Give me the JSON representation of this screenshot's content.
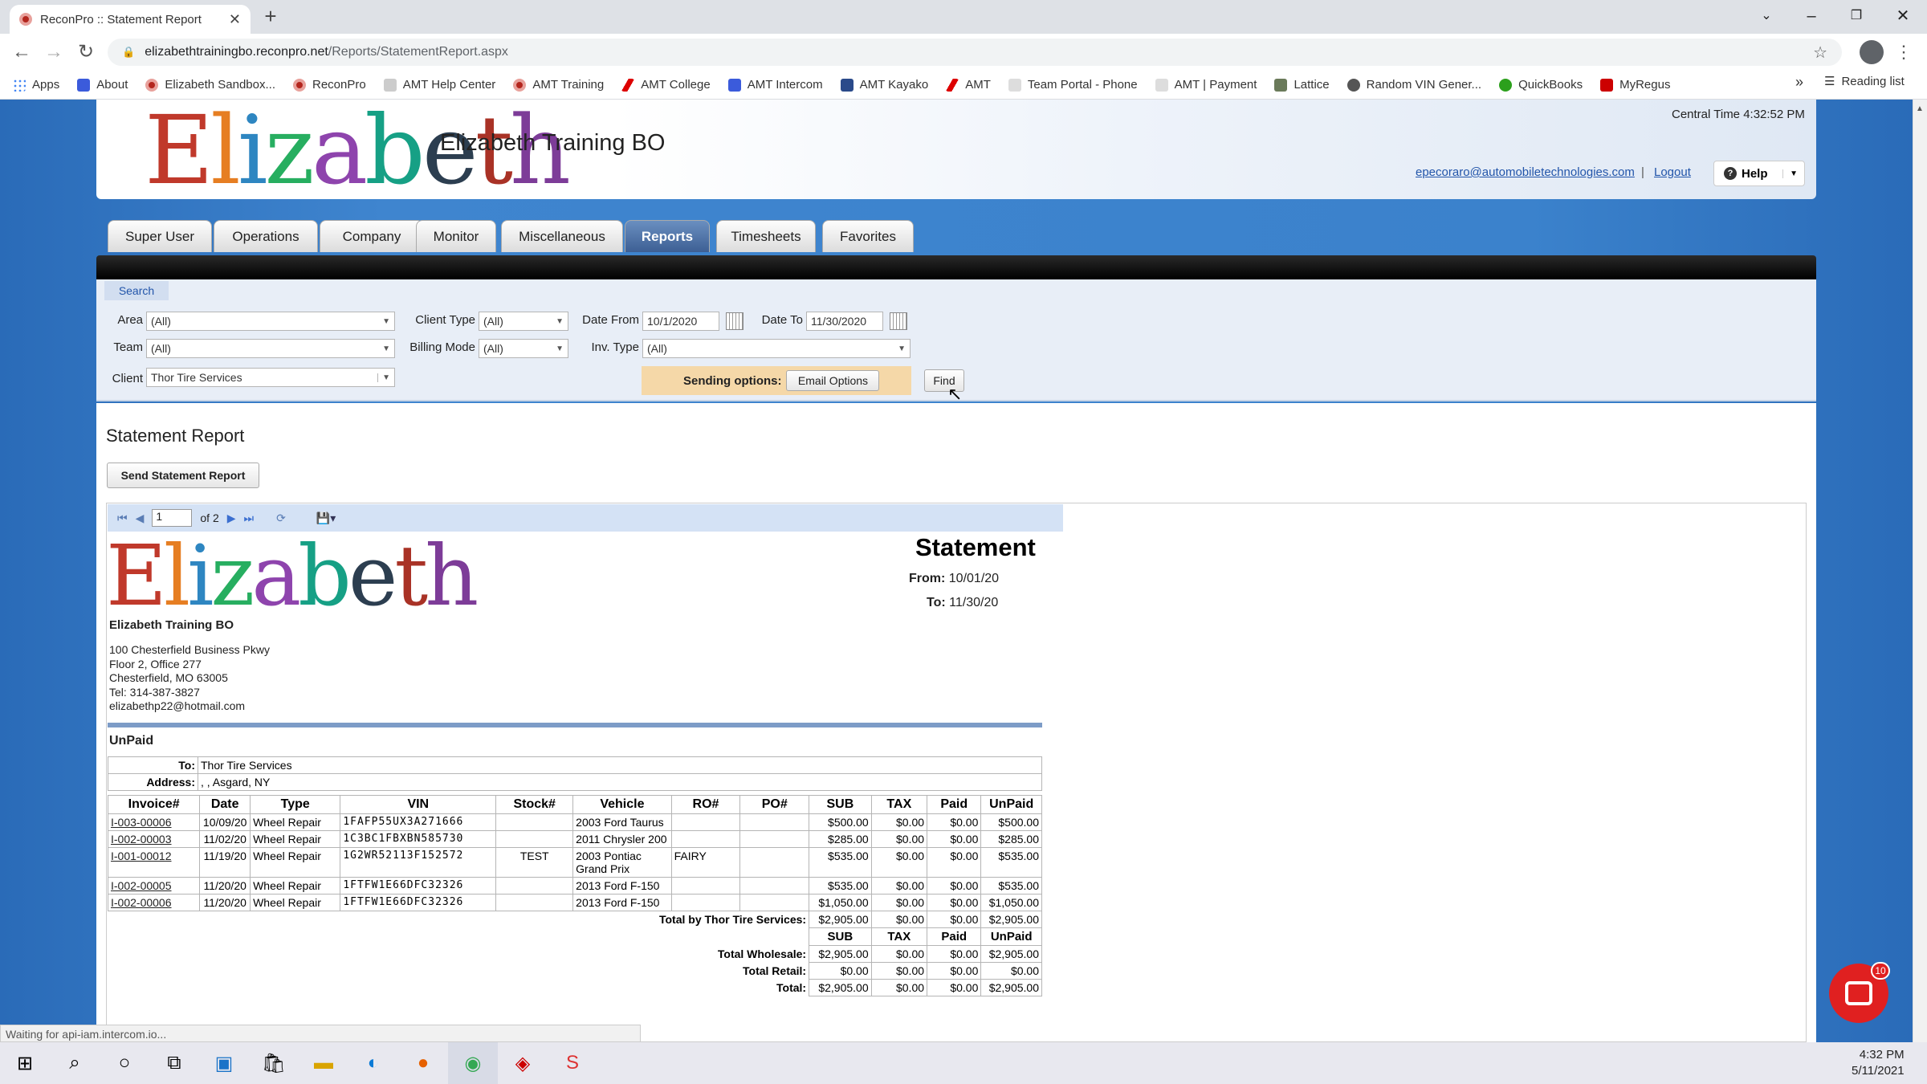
{
  "browser": {
    "tab_title": "ReconPro :: Statement Report",
    "url_host": "elizabethtrainingbo.reconpro.net",
    "url_path": "/Reports/StatementReport.aspx",
    "bookmarks": [
      "Apps",
      "About",
      "Elizabeth Sandbox...",
      "ReconPro",
      "AMT Help Center",
      "AMT Training",
      "AMT College",
      "AMT Intercom",
      "AMT Kayako",
      "AMT",
      "Team Portal - Phone",
      "AMT | Payment",
      "Lattice",
      "Random VIN Gener...",
      "QuickBooks",
      "MyRegus"
    ],
    "reading_list": "Reading list",
    "more": "»"
  },
  "header": {
    "logo": "Elizabeth",
    "org_name": "Elizabeth Training BO",
    "central_time": "Central Time 4:32:52 PM",
    "user_email": "epecoraro@automobiletechnologies.com",
    "separator": "|",
    "logout": "Logout",
    "help": "Help"
  },
  "nav_tabs": [
    "Super User",
    "Operations",
    "Company",
    "Monitor",
    "Miscellaneous",
    "Reports",
    "Timesheets",
    "Favorites"
  ],
  "search": {
    "label": "Search",
    "area_label": "Area",
    "area_value": "(All)",
    "team_label": "Team",
    "team_value": "(All)",
    "client_label": "Client",
    "client_value": "Thor Tire Services",
    "client_type_label": "Client Type",
    "client_type_value": "(All)",
    "billing_mode_label": "Billing Mode",
    "billing_mode_value": "(All)",
    "date_from_label": "Date From",
    "date_from_value": "10/1/2020",
    "date_to_label": "Date To",
    "date_to_value": "11/30/2020",
    "inv_type_label": "Inv. Type",
    "inv_type_value": "(All)",
    "sending_options": "Sending options:",
    "email_options": "Email Options",
    "find": "Find"
  },
  "report": {
    "title": "Statement Report",
    "send_button": "Send Statement Report",
    "page_current": "1",
    "page_of": "of 2",
    "logo": "Elizabeth",
    "company": "Elizabeth Training BO",
    "address_lines": [
      "100 Chesterfield Business Pkwy",
      "Floor 2, Office 277",
      "Chesterfield, MO 63005",
      "Tel: 314-387-3827",
      "elizabethp22@hotmail.com"
    ],
    "statement": "Statement",
    "from_label": "From:",
    "from_value": "10/01/20",
    "to_label": "To:",
    "to_value": "11/30/20",
    "section": "UnPaid",
    "to_row_label": "To:",
    "to_row_value": "Thor Tire Services",
    "address_label": "Address:",
    "address_value": ", , Asgard, NY",
    "columns": [
      "Invoice#",
      "Date",
      "Type",
      "VIN",
      "Stock#",
      "Vehicle",
      "RO#",
      "PO#",
      "SUB",
      "TAX",
      "Paid",
      "UnPaid"
    ],
    "rows": [
      [
        "I-003-00006",
        "10/09/20",
        "Wheel Repair",
        "1FAFP55UX3A271666",
        "",
        "2003 Ford Taurus",
        "",
        "",
        "$500.00",
        "$0.00",
        "$0.00",
        "$500.00"
      ],
      [
        "I-002-00003",
        "11/02/20",
        "Wheel Repair",
        "1C3BC1FBXBN585730",
        "",
        "2011 Chrysler 200",
        "",
        "",
        "$285.00",
        "$0.00",
        "$0.00",
        "$285.00"
      ],
      [
        "I-001-00012",
        "11/19/20",
        "Wheel Repair",
        "1G2WR52113F152572",
        "TEST",
        "2003 Pontiac Grand Prix",
        "FAIRY",
        "",
        "$535.00",
        "$0.00",
        "$0.00",
        "$535.00"
      ],
      [
        "I-002-00005",
        "11/20/20",
        "Wheel Repair",
        "1FTFW1E66DFC32326",
        "",
        "2013 Ford F-150",
        "",
        "",
        "$535.00",
        "$0.00",
        "$0.00",
        "$535.00"
      ],
      [
        "I-002-00006",
        "11/20/20",
        "Wheel Repair",
        "1FTFW1E66DFC32326",
        "",
        "2013 Ford F-150",
        "",
        "",
        "$1,050.00",
        "$0.00",
        "$0.00",
        "$1,050.00"
      ]
    ],
    "total_by_label": "Total by Thor Tire Services:",
    "total_by": [
      "$2,905.00",
      "$0.00",
      "$0.00",
      "$2,905.00"
    ],
    "sum_columns": [
      "SUB",
      "TAX",
      "Paid",
      "UnPaid"
    ],
    "total_wholesale_label": "Total Wholesale:",
    "total_wholesale": [
      "$2,905.00",
      "$0.00",
      "$0.00",
      "$2,905.00"
    ],
    "total_retail_label": "Total Retail:",
    "total_retail": [
      "$0.00",
      "$0.00",
      "$0.00",
      "$0.00"
    ],
    "total_label": "Total:",
    "total": [
      "$2,905.00",
      "$0.00",
      "$0.00",
      "$2,905.00"
    ]
  },
  "status_text": "Waiting for api-iam.intercom.io...",
  "intercom_badge": "10",
  "clock": {
    "time": "4:32 PM",
    "date": "5/11/2021"
  },
  "colors": {
    "accent": "#3b82cc",
    "active_tab": "#3d5f94",
    "sending_bg": "#f5d8a8",
    "intercom": "#e02020"
  }
}
